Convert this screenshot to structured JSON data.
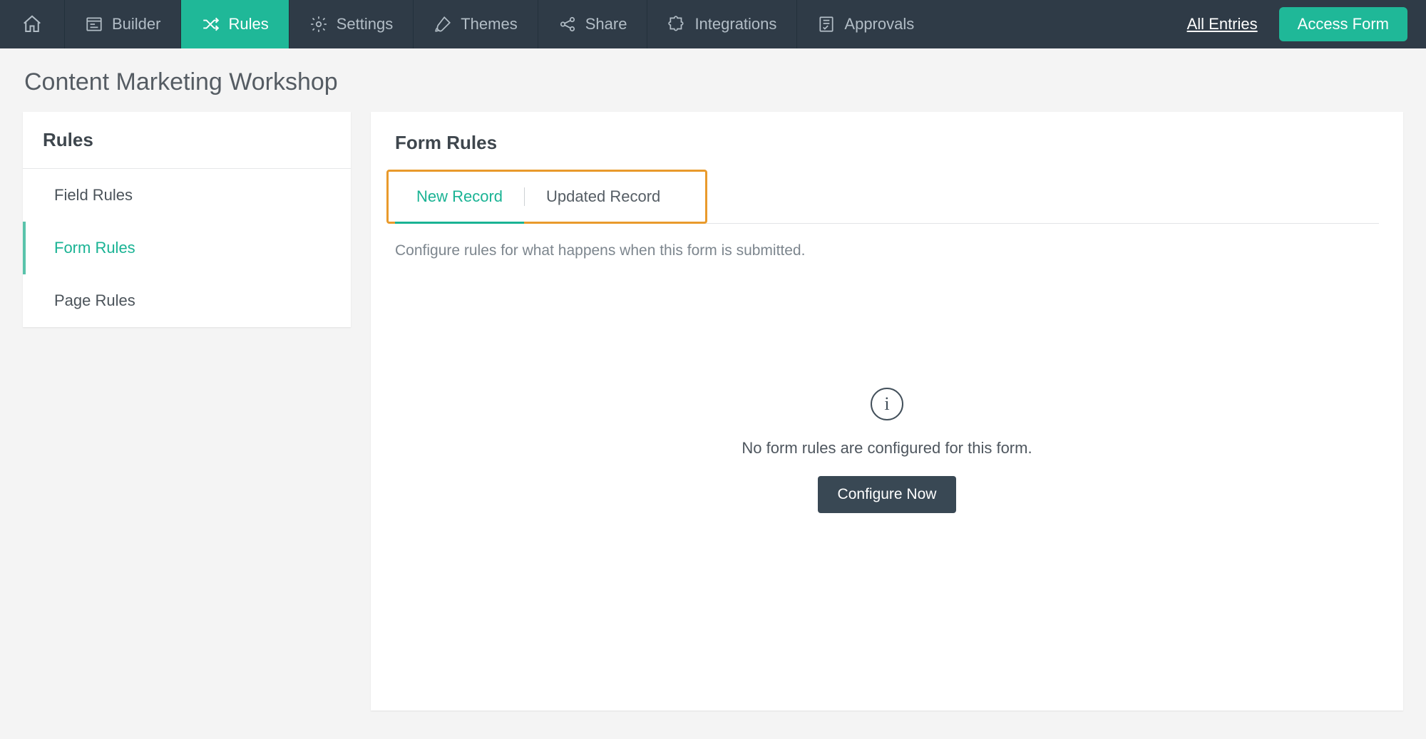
{
  "nav": {
    "items": [
      {
        "label": "Builder"
      },
      {
        "label": "Rules"
      },
      {
        "label": "Settings"
      },
      {
        "label": "Themes"
      },
      {
        "label": "Share"
      },
      {
        "label": "Integrations"
      },
      {
        "label": "Approvals"
      }
    ],
    "all_entries": "All Entries",
    "access_form": "Access Form"
  },
  "page_title": "Content Marketing Workshop",
  "sidebar": {
    "heading": "Rules",
    "items": [
      "Field Rules",
      "Form Rules",
      "Page Rules"
    ],
    "active_index": 1
  },
  "main": {
    "heading": "Form Rules",
    "tabs": [
      "New Record",
      "Updated Record"
    ],
    "active_tab": 0,
    "description": "Configure rules for what happens when this form is submitted.",
    "empty_text": "No form rules are configured for this form.",
    "configure_label": "Configure Now"
  }
}
